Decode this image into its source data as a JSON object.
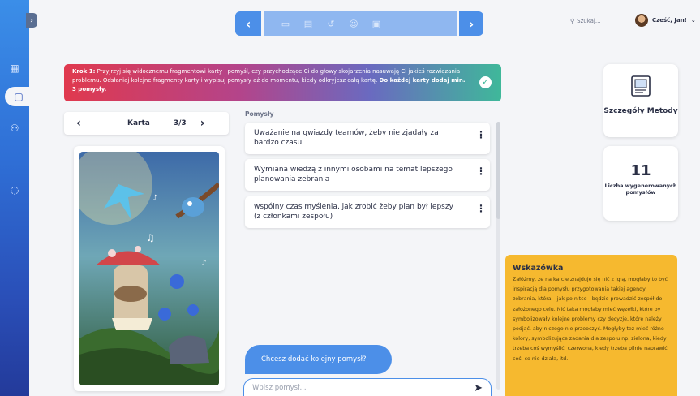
{
  "nav": {
    "rail_items": [
      "grid-icon",
      "board-icon",
      "users-icon",
      "headset-icon"
    ],
    "expand_icon": "chevron-right-icon"
  },
  "toolbar": {
    "prev": "‹",
    "next": "›",
    "tools": [
      "present-icon",
      "notes-icon",
      "undo-icon",
      "emoji-icon",
      "save-icon"
    ]
  },
  "search": {
    "placeholder": "Szukaj..."
  },
  "user": {
    "greeting": "Cześć, Jan!"
  },
  "banner": {
    "step": "Krok 1:",
    "text": " Przyjrzyj się widocznemu fragmentowi karty i pomyśl, czy przychodzące Ci do głowy skojarzenia nasuwają Ci jakieś rozwiązania problemu. Odsłaniaj kolejne fragmenty karty i wypisuj pomysły aż do momentu, kiedy odkryjesz całą kartę. ",
    "emphasis": "Do każdej karty dodaj min. 3 pomysły."
  },
  "card_nav": {
    "label": "Karta",
    "counter": "3/3",
    "prev": "‹",
    "next": "›"
  },
  "ideas": {
    "title": "Pomysły",
    "items": [
      "Uważanie na gwiazdy teamów, żeby nie zjadały za bardzo czasu",
      "Wymiana wiedzą z innymi osobami na temat lepszego planowania zebrania",
      "wspólny czas myślenia, jak zrobić żeby plan był lepszy (z członkami zespołu)"
    ]
  },
  "chat": {
    "prompt": "Chcesz dodać kolejny pomysł?",
    "input_placeholder": "Wpisz pomysł..."
  },
  "method": {
    "title": "Szczegóły Metody"
  },
  "stats": {
    "count": "11",
    "label": "Liczba wygenerowanych pomysłów"
  },
  "hint": {
    "title": "Wskazówka",
    "text": "Załóżmy, że na karcie znajduje się nić z igłą, mogłaby to być inspiracją dla pomysłu przygotowania takiej agendy zebrania, która – jak po nitce - będzie prowadzić zespół do założonego celu. Nić taka mogłaby mieć węzełki, które by symbolizowały kolejne problemy czy decyzje, które należy podjąć, aby niczego nie przeoczyć. Mogłyby też mieć różne kolory, symbolizujące zadania dla zespołu np. zielona, kiedy trzeba coś wymyślić; czerwona, kiedy trzeba pilnie naprawić coś, co nie działa, itd."
  },
  "colors": {
    "accent": "#4c8fe8",
    "hint_bg": "#f6b92f",
    "banner_start": "#e0394e",
    "banner_end": "#3fb89a"
  }
}
